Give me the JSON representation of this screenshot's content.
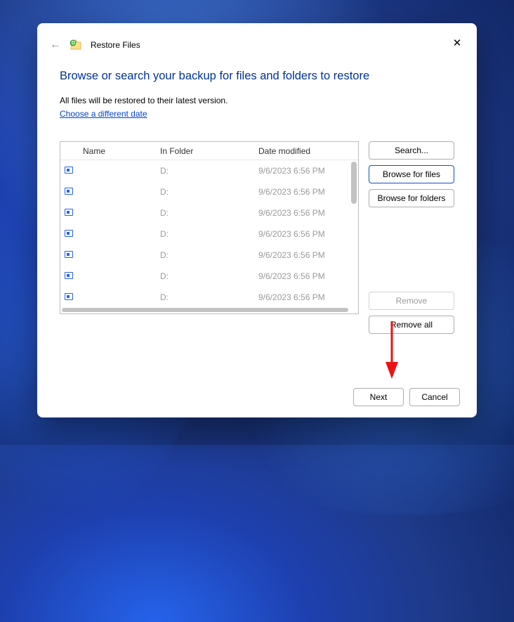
{
  "window": {
    "title": "Restore Files"
  },
  "heading": "Browse or search your backup for files and folders to restore",
  "subtext": "All files will be restored to their latest version.",
  "link_text": "Choose a different date",
  "columns": {
    "name": "Name",
    "folder": "In Folder",
    "date": "Date modified"
  },
  "rows": [
    {
      "name": "",
      "folder": "D:",
      "date": "9/6/2023 6:56 PM"
    },
    {
      "name": "",
      "folder": "D:",
      "date": "9/6/2023 6:56 PM"
    },
    {
      "name": "",
      "folder": "D:",
      "date": "9/6/2023 6:56 PM"
    },
    {
      "name": "",
      "folder": "D:",
      "date": "9/6/2023 6:56 PM"
    },
    {
      "name": "",
      "folder": "D:",
      "date": "9/6/2023 6:56 PM"
    },
    {
      "name": "",
      "folder": "D:",
      "date": "9/6/2023 6:56 PM"
    },
    {
      "name": "",
      "folder": "D:",
      "date": "9/6/2023 6:56 PM"
    }
  ],
  "side_buttons": {
    "search": "Search...",
    "browse_files": "Browse for files",
    "browse_folders": "Browse for folders",
    "remove": "Remove",
    "remove_all": "Remove all"
  },
  "footer_buttons": {
    "next": "Next",
    "cancel": "Cancel"
  }
}
